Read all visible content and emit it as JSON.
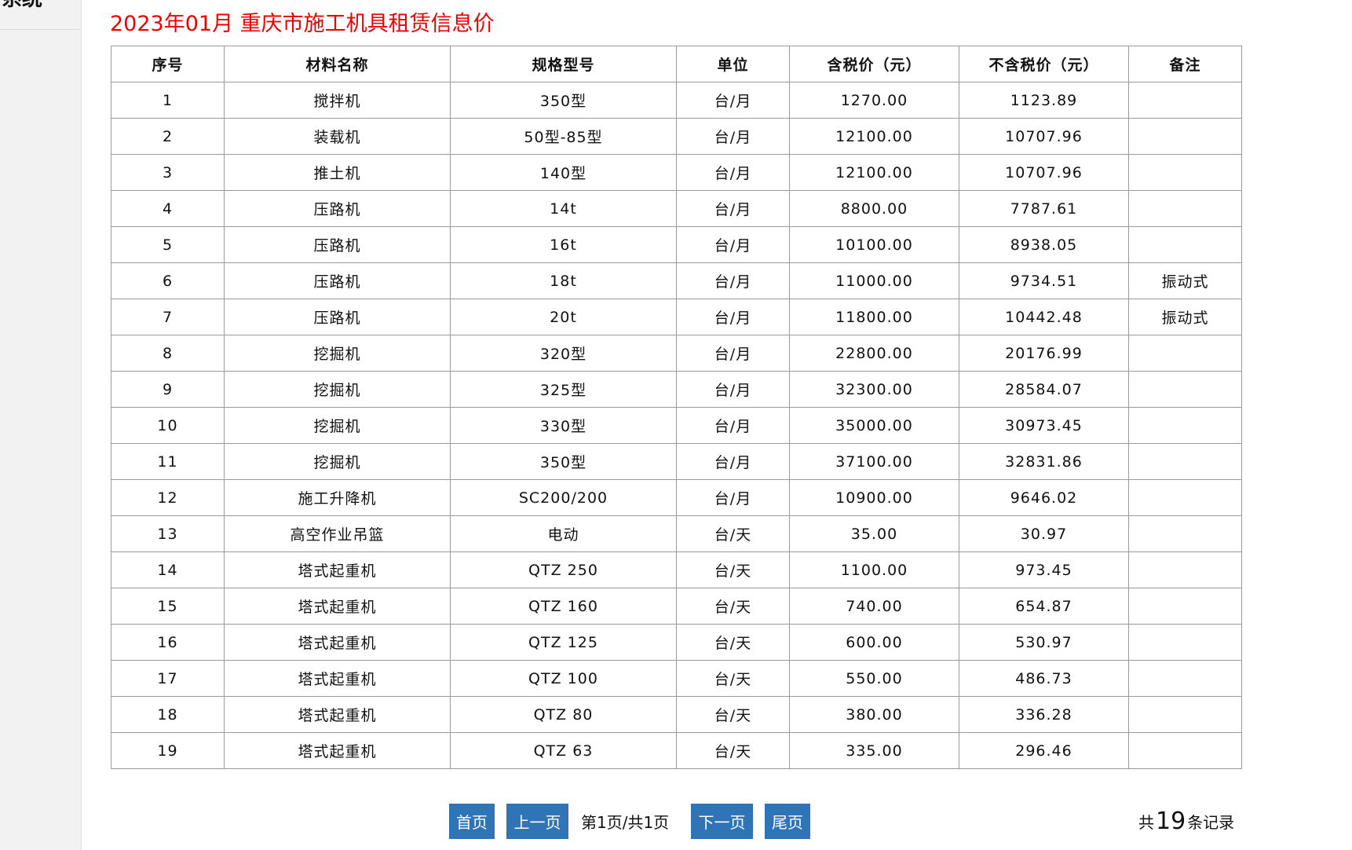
{
  "sidebar": {
    "title": "系统"
  },
  "page_title": "2023年01月 重庆市施工机具租赁信息价",
  "table": {
    "headers": [
      "序号",
      "材料名称",
      "规格型号",
      "单位",
      "含税价（元）",
      "不含税价（元）",
      "备注"
    ],
    "rows": [
      [
        "1",
        "搅拌机",
        "350型",
        "台/月",
        "1270.00",
        "1123.89",
        ""
      ],
      [
        "2",
        "装载机",
        "50型-85型",
        "台/月",
        "12100.00",
        "10707.96",
        ""
      ],
      [
        "3",
        "推土机",
        "140型",
        "台/月",
        "12100.00",
        "10707.96",
        ""
      ],
      [
        "4",
        "压路机",
        "14t",
        "台/月",
        "8800.00",
        "7787.61",
        ""
      ],
      [
        "5",
        "压路机",
        "16t",
        "台/月",
        "10100.00",
        "8938.05",
        ""
      ],
      [
        "6",
        "压路机",
        "18t",
        "台/月",
        "11000.00",
        "9734.51",
        "振动式"
      ],
      [
        "7",
        "压路机",
        "20t",
        "台/月",
        "11800.00",
        "10442.48",
        "振动式"
      ],
      [
        "8",
        "挖掘机",
        "320型",
        "台/月",
        "22800.00",
        "20176.99",
        ""
      ],
      [
        "9",
        "挖掘机",
        "325型",
        "台/月",
        "32300.00",
        "28584.07",
        ""
      ],
      [
        "10",
        "挖掘机",
        "330型",
        "台/月",
        "35000.00",
        "30973.45",
        ""
      ],
      [
        "11",
        "挖掘机",
        "350型",
        "台/月",
        "37100.00",
        "32831.86",
        ""
      ],
      [
        "12",
        "施工升降机",
        "SC200/200",
        "台/月",
        "10900.00",
        "9646.02",
        ""
      ],
      [
        "13",
        "高空作业吊篮",
        "电动",
        "台/天",
        "35.00",
        "30.97",
        ""
      ],
      [
        "14",
        "塔式起重机",
        "QTZ 250",
        "台/天",
        "1100.00",
        "973.45",
        ""
      ],
      [
        "15",
        "塔式起重机",
        "QTZ 160",
        "台/天",
        "740.00",
        "654.87",
        ""
      ],
      [
        "16",
        "塔式起重机",
        "QTZ 125",
        "台/天",
        "600.00",
        "530.97",
        ""
      ],
      [
        "17",
        "塔式起重机",
        "QTZ 100",
        "台/天",
        "550.00",
        "486.73",
        ""
      ],
      [
        "18",
        "塔式起重机",
        "QTZ 80",
        "台/天",
        "380.00",
        "336.28",
        ""
      ],
      [
        "19",
        "塔式起重机",
        "QTZ 63",
        "台/天",
        "335.00",
        "296.46",
        ""
      ]
    ]
  },
  "pager": {
    "first": "首页",
    "prev": "上一页",
    "info": "第1页/共1页",
    "next": "下一页",
    "last": "尾页"
  },
  "total": {
    "prefix": "共",
    "count": "19",
    "suffix": "条记录"
  },
  "colors": {
    "title": "#ee0000",
    "button": "#2f74b7",
    "border": "#9a9a9a"
  }
}
